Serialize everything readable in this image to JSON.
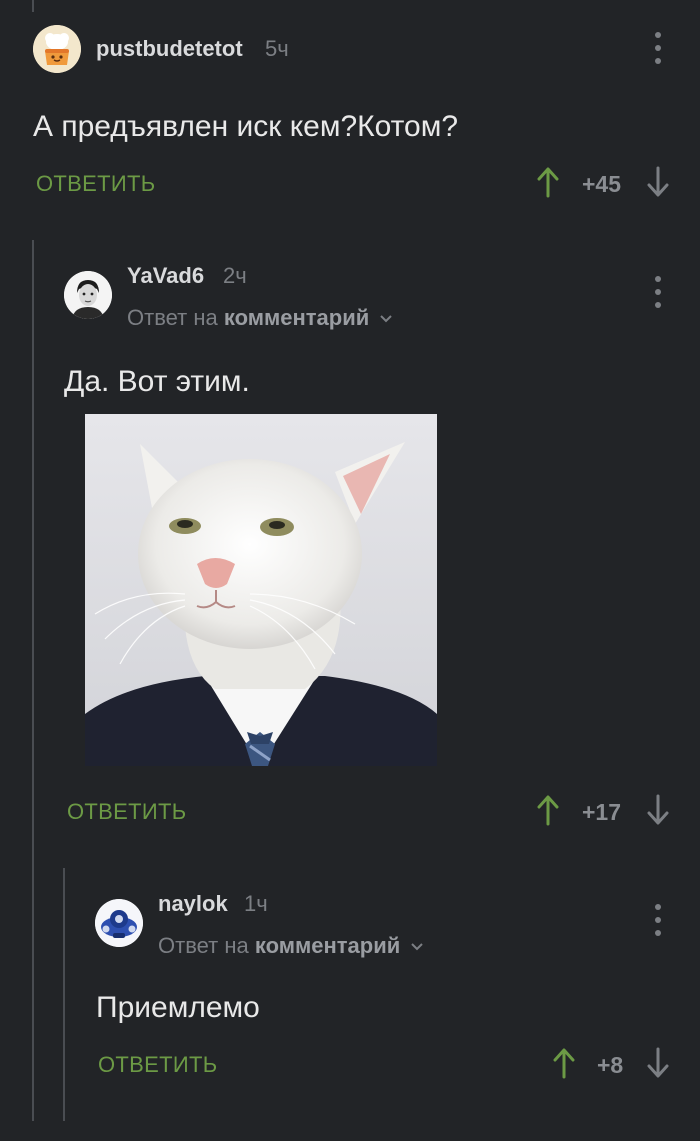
{
  "comments": [
    {
      "username": "pustbudetetot",
      "time": "5ч",
      "text": "А предъявлен иск кем?Котом?",
      "reply_label": "ОТВЕТИТЬ",
      "score": "+45",
      "avatar_icon": "cake-avatar-icon"
    },
    {
      "username": "YaVad6",
      "time": "2ч",
      "reply_to_prefix": "Ответ на",
      "reply_to_target": "комментарий",
      "text": "Да. Вот этим.",
      "reply_label": "ОТВЕТИТЬ",
      "score": "+17",
      "avatar_icon": "boy-portrait-avatar-icon",
      "image_icon": "cat-in-suit-image"
    },
    {
      "username": "naylok",
      "time": "1ч",
      "reply_to_prefix": "Ответ на",
      "reply_to_target": "комментарий",
      "text": "Приемлемо",
      "reply_label": "ОТВЕТИТЬ",
      "score": "+8",
      "avatar_icon": "robot-avatar-icon"
    }
  ],
  "colors": {
    "background": "#222427",
    "accent_green": "#6c9a45",
    "muted": "#7c7f84"
  }
}
